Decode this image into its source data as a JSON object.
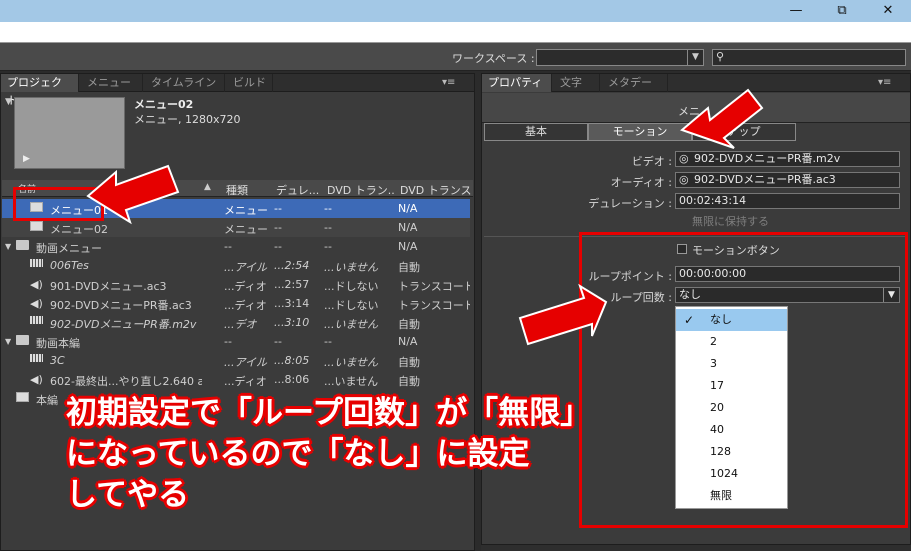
{
  "window": {
    "minimize": "—",
    "maximize": "⧉",
    "close": "✕"
  },
  "workspace": {
    "label": "ワークスペース :",
    "select_value": "",
    "search_icon_glyph": "⚲"
  },
  "left_panel": {
    "tabs": [
      {
        "label": "プロジェクト",
        "close": "×"
      },
      {
        "label": "メニュー"
      },
      {
        "label": "タイムライン"
      },
      {
        "label": "ビルド"
      }
    ],
    "menu_glyph": "▾≡",
    "preview": {
      "name": "メニュー02",
      "desc": "メニュー, 1280x720"
    },
    "columns": [
      "名前",
      "種類",
      "デュレ...",
      "DVD トラン...",
      "DVD トランスコ"
    ],
    "rows": [
      {
        "icon": "menu",
        "indent": 1,
        "name": "メニュー01",
        "type": "メニュー",
        "dur": "--",
        "dvd1": "--",
        "dvd2": "N/A",
        "state": "sel"
      },
      {
        "icon": "menu",
        "indent": 1,
        "name": "メニュー02",
        "type": "メニュー",
        "dur": "--",
        "dvd1": "--",
        "dvd2": "N/A",
        "state": "alt"
      },
      {
        "icon": "folder",
        "indent": 0,
        "name": "動画メニュー",
        "type": "--",
        "dur": "--",
        "dvd1": "--",
        "dvd2": "N/A",
        "state": ""
      },
      {
        "icon": "film",
        "indent": 1,
        "name": "006Tes",
        "type": "...アイル",
        "dur": "...2:54",
        "dvd1": "...いません",
        "dvd2": "自動",
        "state": "",
        "italic": true
      },
      {
        "icon": "speaker",
        "indent": 1,
        "name": "901-DVDメニュー.ac3",
        "type": "...ディオ",
        "dur": "...2:57",
        "dvd1": "...ドしない",
        "dvd2": "トランスコード...",
        "state": ""
      },
      {
        "icon": "speaker",
        "indent": 1,
        "name": "902-DVDメニューPR番.ac3",
        "type": "...ディオ",
        "dur": "...3:14",
        "dvd1": "...ドしない",
        "dvd2": "トランスコード...",
        "state": ""
      },
      {
        "icon": "film",
        "indent": 1,
        "name": "902-DVDメニューPR番.m2v",
        "type": "...デオ",
        "dur": "...3:10",
        "dvd1": "...いません",
        "dvd2": "自動",
        "state": "",
        "italic": true
      },
      {
        "icon": "folder",
        "indent": 0,
        "name": "動画本編",
        "type": "--",
        "dur": "--",
        "dvd1": "--",
        "dvd2": "N/A",
        "state": ""
      },
      {
        "icon": "film",
        "indent": 1,
        "name": "3C",
        "type": "...アイル",
        "dur": "...8:05",
        "dvd1": "...いません",
        "dvd2": "自動",
        "state": "",
        "italic": true
      },
      {
        "icon": "speaker",
        "indent": 1,
        "name": "602-最終出...やり直し2.640 ac3",
        "type": "...ディオ",
        "dur": "...8:06",
        "dvd1": "...いません",
        "dvd2": "自動",
        "state": ""
      },
      {
        "icon": "menu",
        "indent": 0,
        "name": "本編",
        "type": "",
        "dur": "",
        "dvd1": "",
        "dvd2": "",
        "state": ""
      }
    ]
  },
  "right_panel": {
    "tabs": [
      {
        "label": "プロパティ",
        "close": "×"
      },
      {
        "label": "文字"
      },
      {
        "label": "メタデータ"
      }
    ],
    "menu_glyph": "▾≡",
    "header_title": "メニ",
    "subtabs": [
      "基本",
      "モーション",
      "アップ"
    ],
    "video_label": "ビデオ :",
    "video_value": "902-DVDメニューPR番.m2v",
    "audio_label": "オーディオ :",
    "audio_value": "902-DVDメニューPR番.ac3",
    "duration_label": "デュレーション :",
    "duration_value": "00:02:43:14",
    "hold_forever": "無限に保持する",
    "motion_button_label": "モーションボタン",
    "loop_point_label": "ループポイント :",
    "loop_point_value": "00:00:00:00",
    "loop_count_label": "ループ回数 :",
    "loop_count_value": "なし",
    "loop_options": [
      "なし",
      "2",
      "3",
      "17",
      "20",
      "40",
      "128",
      "1024",
      "無限"
    ],
    "selected_option": "なし"
  },
  "annotation": {
    "line1": "初期設定で「ループ回数」が「無限」",
    "line2": "になっているので「なし」に設定",
    "line3": "してやる",
    "color": "#e60000"
  }
}
